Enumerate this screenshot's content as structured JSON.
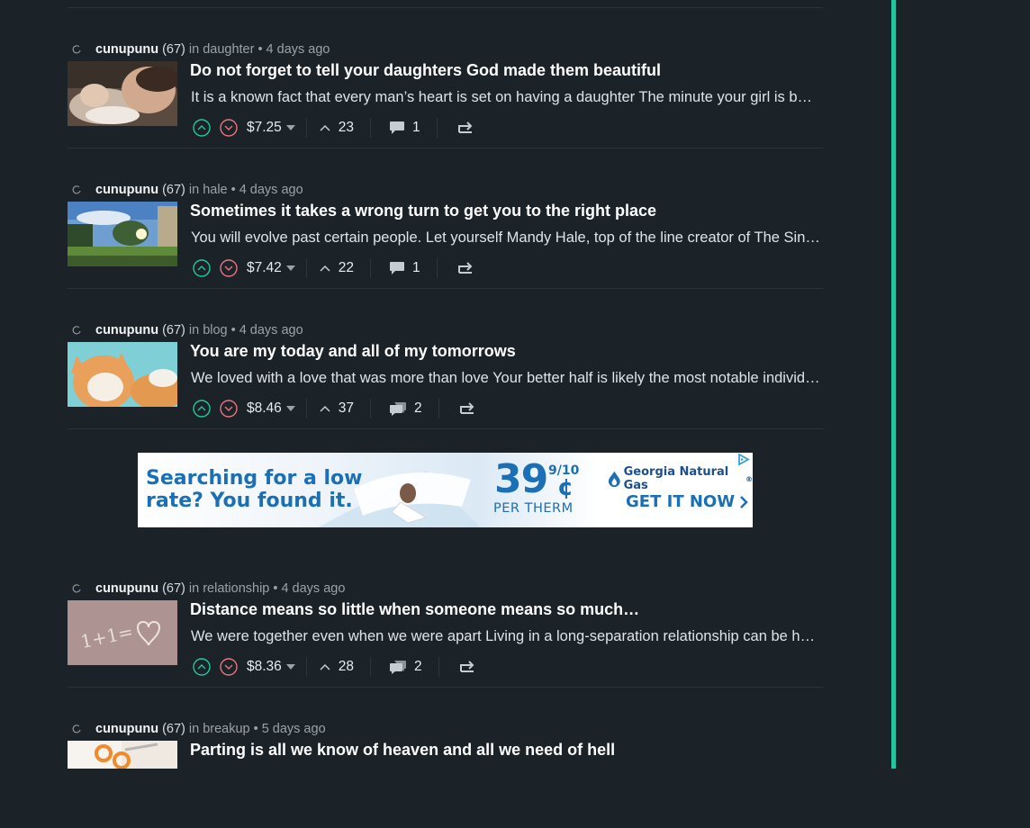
{
  "posts": [
    {
      "author": "cunupunu",
      "reputation": "(67)",
      "in_word": "in",
      "category": "daughter",
      "separator": "•",
      "time": "4 days ago",
      "title": "Do not forget to tell your daughters God made them beautiful",
      "excerpt": "It is a known fact that every man’s heart is set on having a daughter The minute your girl is born, your life changes",
      "payout": "$7.25",
      "votes": "23",
      "comments": "1",
      "thumbnail": "sleeping-baby-photo"
    },
    {
      "author": "cunupunu",
      "reputation": "(67)",
      "in_word": "in",
      "category": "hale",
      "separator": "•",
      "time": "4 days ago",
      "title": "Sometimes it takes a wrong turn to get you to the right place",
      "excerpt": "You will evolve past certain people. Let yourself Mandy Hale, top of the line creator of The Single Woman",
      "payout": "$7.42",
      "votes": "22",
      "comments": "1",
      "thumbnail": "sunset-park-photo"
    },
    {
      "author": "cunupunu",
      "reputation": "(67)",
      "in_word": "in",
      "category": "blog",
      "separator": "•",
      "time": "4 days ago",
      "title": "You are my today and all of my tomorrows",
      "excerpt": "We loved with a love that was more than love  Your better half is likely the most notable individual in your life",
      "payout": "$8.46",
      "votes": "37",
      "comments": "2",
      "thumbnail": "orange-cat-photo"
    },
    {
      "author": "cunupunu",
      "reputation": "(67)",
      "in_word": "in",
      "category": "relationship",
      "separator": "•",
      "time": "4 days ago",
      "title": "Distance means so little when someone means so much…",
      "excerpt": "We were together even when we were apart  Living in a long-separation relationship can be hard",
      "payout": "$8.36",
      "votes": "28",
      "comments": "2",
      "thumbnail": "sand-heart-photo"
    },
    {
      "author": "cunupunu",
      "reputation": "(67)",
      "in_word": "in",
      "category": "breakup",
      "separator": "•",
      "time": "5 days ago",
      "title": "Parting is all we know of heaven and all we need of hell",
      "thumbnail": "scissors-paper-photo"
    }
  ],
  "ad": {
    "headline_line1": "Searching for a low",
    "headline_line2": "rate? You found it.",
    "price": "39",
    "fraction": "9/10",
    "cents_sign": "¢",
    "unit": "PER THERM",
    "brand": "Georgia Natural Gas",
    "brand_mark": "®",
    "cta": "GET IT NOW",
    "adchoices": "ad-choices-icon"
  },
  "colors": {
    "background": "#1b2228",
    "accent": "#1fc8a0",
    "upvote": "#1fc8a0",
    "downvote": "#e8757d",
    "ad_blue": "#1a6fb5"
  }
}
